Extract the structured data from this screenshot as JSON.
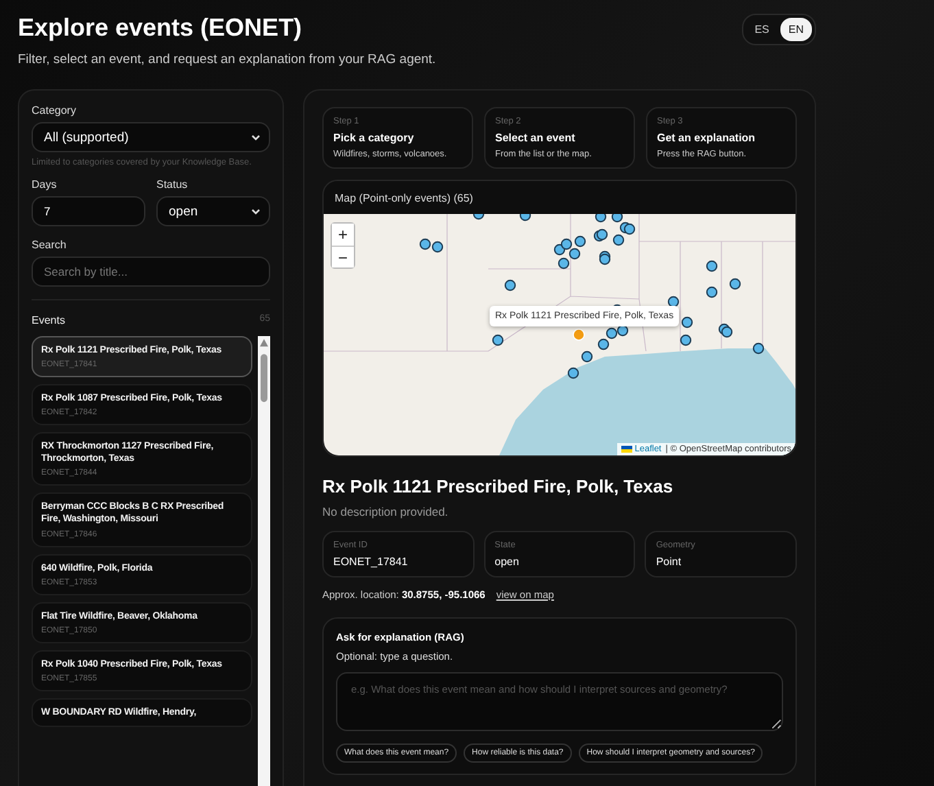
{
  "header": {
    "title": "Explore events (EONET)",
    "subtitle": "Filter, select an event, and request an explanation from your RAG agent."
  },
  "languages": [
    {
      "label": "ES",
      "selected": false
    },
    {
      "label": "EN",
      "selected": true
    }
  ],
  "filters": {
    "category_label": "Category",
    "category_value": "All (supported)",
    "category_hint": "Limited to categories covered by your Knowledge Base.",
    "days_label": "Days",
    "days_value": "7",
    "status_label": "Status",
    "status_value": "open",
    "search_label": "Search",
    "search_placeholder": "Search by title..."
  },
  "events_header": {
    "label": "Events",
    "count": "65"
  },
  "events": [
    {
      "title": "Rx Polk 1121 Prescribed Fire, Polk, Texas",
      "id": "EONET_17841",
      "selected": true
    },
    {
      "title": "Rx Polk 1087 Prescribed Fire, Polk, Texas",
      "id": "EONET_17842",
      "selected": false
    },
    {
      "title": "RX Throckmorton 1127 Prescribed Fire, Throckmorton, Texas",
      "id": "EONET_17844",
      "selected": false
    },
    {
      "title": "Berryman CCC Blocks B C RX Prescribed Fire, Washington, Missouri",
      "id": "EONET_17846",
      "selected": false
    },
    {
      "title": "640 Wildfire, Polk, Florida",
      "id": "EONET_17853",
      "selected": false
    },
    {
      "title": "Flat Tire Wildfire, Beaver, Oklahoma",
      "id": "EONET_17850",
      "selected": false
    },
    {
      "title": "Rx Polk 1040 Prescribed Fire, Polk, Texas",
      "id": "EONET_17855",
      "selected": false
    },
    {
      "title": "W BOUNDARY RD Wildfire, Hendry,",
      "selected": false
    }
  ],
  "steps": [
    {
      "step": "Step 1",
      "title": "Pick a category",
      "text": "Wildfires, storms, volcanoes."
    },
    {
      "step": "Step 2",
      "title": "Select an event",
      "text": "From the list or the map."
    },
    {
      "step": "Step 3",
      "title": "Get an explanation",
      "text": "Press the RAG button."
    }
  ],
  "map": {
    "title": "Map (Point-only events) (65)",
    "zoom_in": "+",
    "zoom_out": "−",
    "tooltip": "Rx Polk 1121 Prescribed Fire, Polk, Texas",
    "attribution_link": "Leaflet",
    "attribution_text": "| © OpenStreetMap contributors"
  },
  "detail": {
    "title": "Rx Polk 1121 Prescribed Fire, Polk, Texas",
    "description": "No description provided.",
    "fields": [
      {
        "label": "Event ID",
        "value": "EONET_17841"
      },
      {
        "label": "State",
        "value": "open"
      },
      {
        "label": "Geometry",
        "value": "Point"
      }
    ],
    "location": "Approx. location: **30.8755, -95.1066**",
    "location_link": "view on map"
  },
  "ask": {
    "title": "Ask for explanation (RAG)",
    "subtitle": "Optional: type a question.",
    "placeholder": "e.g. What does this event mean and how should I interpret sources and geometry?",
    "suggestions": [
      "What does this event mean?",
      "How reliable is this data?",
      "How should I interpret geometry and sources?"
    ]
  }
}
